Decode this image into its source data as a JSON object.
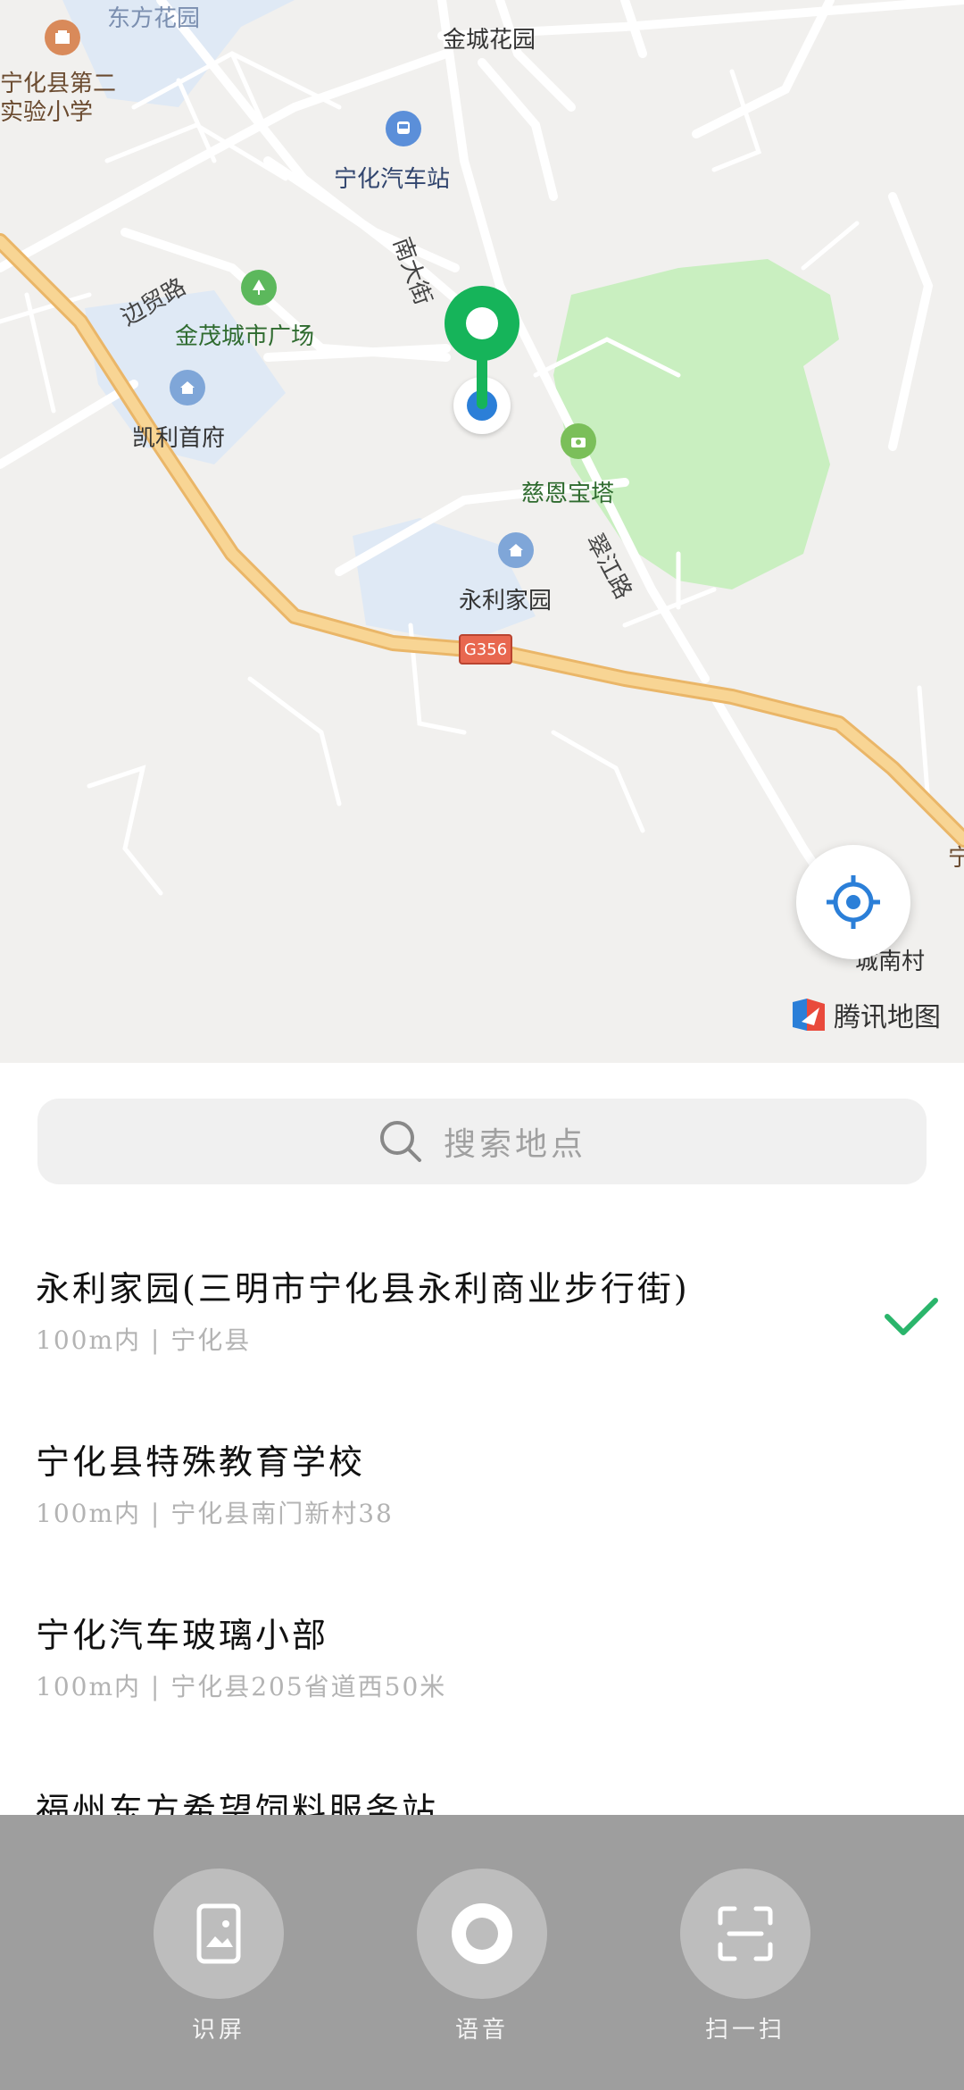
{
  "map": {
    "labels": {
      "dongfang": "东方花园",
      "jincheng": "金城花园",
      "ninghua_school": "宁化县第二\n实验小学",
      "bus_station": "宁化汽车站",
      "nanda": "南大街",
      "maoyi": "边贸路",
      "jinmao": "金茂城市广场",
      "kaili": "凯利首府",
      "cien": "慈恩宝塔",
      "cuijiang": "翠江路",
      "yongli": "永利家园",
      "road_code": "G356",
      "nancun": "城南村",
      "edge_char": "宁"
    },
    "provider": "腾讯地图"
  },
  "search": {
    "placeholder": "搜索地点"
  },
  "places": [
    {
      "name": "永利家园(三明市宁化县永利商业步行街)",
      "sub": "100m内 | 宁化县",
      "selected": true
    },
    {
      "name": "宁化县特殊教育学校",
      "sub": "100m内 | 宁化县南门新村38",
      "selected": false
    },
    {
      "name": "宁化汽车玻璃小部",
      "sub": "100m内 | 宁化县205省道西50米",
      "selected": false
    },
    {
      "name": "福州东方希望饲料服务站",
      "sub": "",
      "selected": false
    }
  ],
  "actions": [
    {
      "label": "识屏",
      "icon": "image-icon"
    },
    {
      "label": "语音",
      "icon": "voice-icon"
    },
    {
      "label": "扫一扫",
      "icon": "scan-icon"
    }
  ],
  "colors": {
    "pin": "#16b45a",
    "dot": "#2b7fd8",
    "highway": "#f6cf86",
    "park": "#c9efc0",
    "water": "#dfe9f5",
    "check": "#2ab56b"
  }
}
